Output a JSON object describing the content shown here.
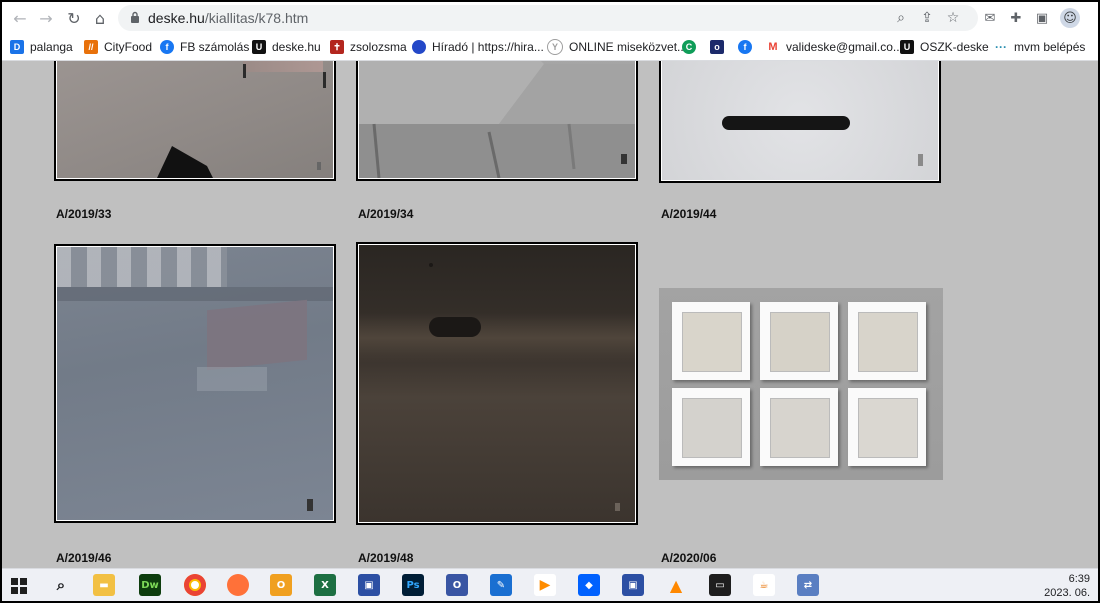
{
  "browser": {
    "url_domain": "deske.hu",
    "url_path": "/kiallitas/k78.htm",
    "bookmarks": [
      {
        "label": "palanga",
        "icon": "d-letter-icon",
        "color": "#1a73e8"
      },
      {
        "label": "CityFood",
        "icon": "cityfood-icon",
        "color": "#e8710a"
      },
      {
        "label": "FB számolás",
        "icon": "facebook-icon",
        "color": "#1877f2"
      },
      {
        "label": "deske.hu",
        "icon": "deske-icon",
        "color": "#111111"
      },
      {
        "label": "zsolozsma",
        "icon": "zsolozsma-icon",
        "color": "#b3261e"
      },
      {
        "label": "Híradó | https://hira...",
        "icon": "hirado-icon",
        "color": "#2448c8"
      },
      {
        "label": "ONLINE miseközvet...",
        "icon": "online-mise-icon",
        "color": "#9e9e9e"
      },
      {
        "label": "",
        "icon": "green-c-icon",
        "color": "#0f9d58"
      },
      {
        "label": "",
        "icon": "blue-square-icon",
        "color": "#1c2a6b"
      },
      {
        "label": "",
        "icon": "facebook-icon",
        "color": "#1877f2"
      },
      {
        "label": "valideske@gmail.co...",
        "icon": "gmail-icon",
        "color": "#ea4335"
      },
      {
        "label": "OSZK-deske",
        "icon": "oszk-icon",
        "color": "#111111"
      },
      {
        "label": "mvm belépés",
        "icon": "mvm-icon",
        "color": "#2a8fb0"
      }
    ]
  },
  "gallery": {
    "items": [
      {
        "caption": "A/2019/33"
      },
      {
        "caption": "A/2019/34"
      },
      {
        "caption": "A/2019/44"
      },
      {
        "caption": "A/2019/46"
      },
      {
        "caption": "A/2019/48"
      },
      {
        "caption": "A/2020/06"
      }
    ]
  },
  "taskbar": {
    "time": "6:39",
    "date": "2023. 06."
  }
}
